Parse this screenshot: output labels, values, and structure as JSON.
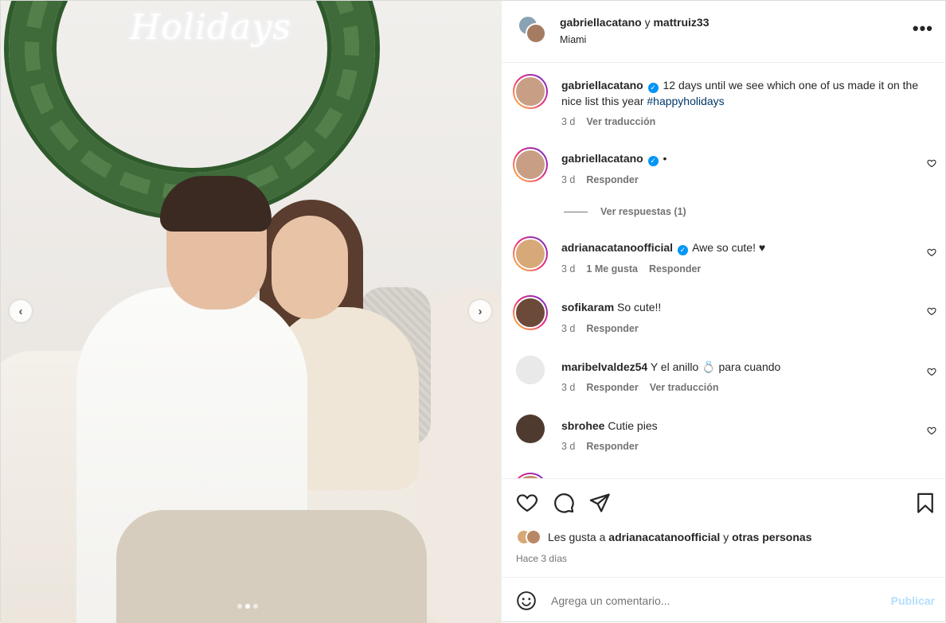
{
  "header": {
    "user1": "gabriellacatano",
    "connector": "y",
    "user2": "mattruiz33",
    "location": "Miami"
  },
  "media": {
    "neon_text": "Holidays",
    "prev_label": "‹",
    "next_label": "›",
    "slide_count": 3,
    "active_slide": 2
  },
  "caption": {
    "username": "gabriellacatano",
    "text": "12 days until we see which one of us made it on the nice list this year",
    "hashtag": "#happyholidays",
    "time": "3 d",
    "translate": "Ver traducción"
  },
  "comments": [
    {
      "username": "gabriellacatano",
      "verified": true,
      "text": "•",
      "time": "3 d",
      "likes": "",
      "reply": "Responder"
    },
    {
      "username": "adrianacatanoofficial",
      "verified": true,
      "text": "Awe so cute! ♥",
      "time": "3 d",
      "likes": "1 Me gusta",
      "reply": "Responder"
    },
    {
      "username": "sofikaram",
      "verified": false,
      "text": "So cute!!",
      "time": "3 d",
      "likes": "",
      "reply": "Responder"
    },
    {
      "username": "maribelvaldez54",
      "verified": false,
      "text": "Y el anillo 💍 para cuando",
      "time": "3 d",
      "likes": "",
      "reply": "Responder",
      "translate": "Ver traducción"
    },
    {
      "username": "sbrohee",
      "verified": false,
      "text": "Cutie pies",
      "time": "3 d",
      "likes": "",
      "reply": "Responder"
    }
  ],
  "view_replies": "Ver respuestas (1)",
  "likes": {
    "prefix": "Les gusta a",
    "user": "adrianacatanoofficial",
    "conjunction": "y",
    "others": "otras personas"
  },
  "posted": "Hace 3 días",
  "add_comment": {
    "placeholder": "Agrega un comentario...",
    "publish": "Publicar"
  },
  "colors": {
    "link": "#00376b",
    "verified": "#0095f6",
    "muted": "#737373",
    "publish_disabled": "#b2dffc"
  }
}
